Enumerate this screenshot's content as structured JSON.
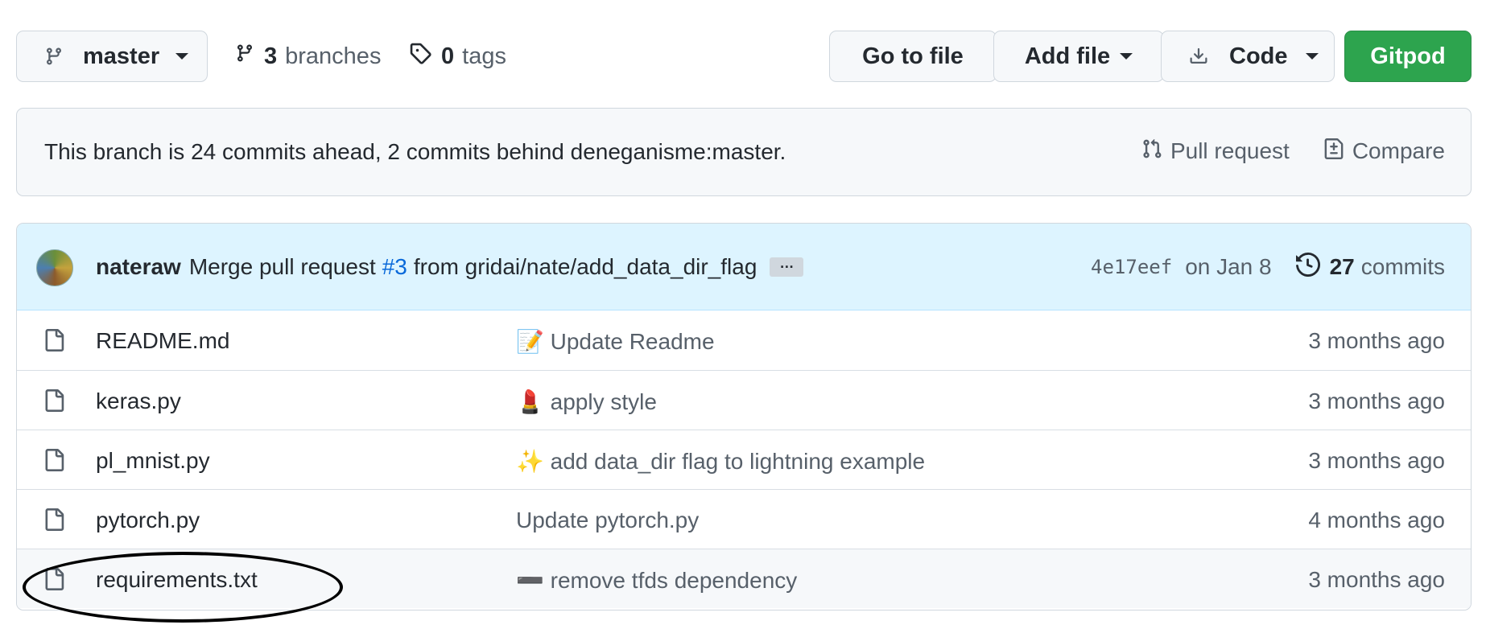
{
  "toolbar": {
    "branch": "master",
    "branches_count": "3",
    "branches_label": "branches",
    "tags_count": "0",
    "tags_label": "tags",
    "go_to_file": "Go to file",
    "add_file": "Add file",
    "code": "Code",
    "gitpod": "Gitpod"
  },
  "branch_status": {
    "text": "This branch is 24 commits ahead, 2 commits behind deneganisme:master.",
    "pull_request": "Pull request",
    "compare": "Compare"
  },
  "latest_commit": {
    "author": "nateraw",
    "message_prefix": "Merge pull request",
    "pr_number": "#3",
    "message_suffix": "from gridai/nate/add_data_dir_flag",
    "ellipsis": "…",
    "sha": "4e17eef",
    "date": "on Jan 8",
    "commits_count": "27",
    "commits_label": "commits"
  },
  "files": [
    {
      "name": "README.md",
      "message": "📝 Update Readme",
      "age": "3 months ago"
    },
    {
      "name": "keras.py",
      "message": "💄 apply style",
      "age": "3 months ago"
    },
    {
      "name": "pl_mnist.py",
      "message": "✨ add data_dir flag to lightning example",
      "age": "3 months ago"
    },
    {
      "name": "pytorch.py",
      "message": "Update pytorch.py",
      "age": "4 months ago"
    },
    {
      "name": "requirements.txt",
      "message": "➖ remove tfds dependency",
      "age": "3 months ago"
    }
  ],
  "colors": {
    "primary_button": "#2da44e",
    "link": "#0969da",
    "commit_bar": "#ddf4ff"
  }
}
